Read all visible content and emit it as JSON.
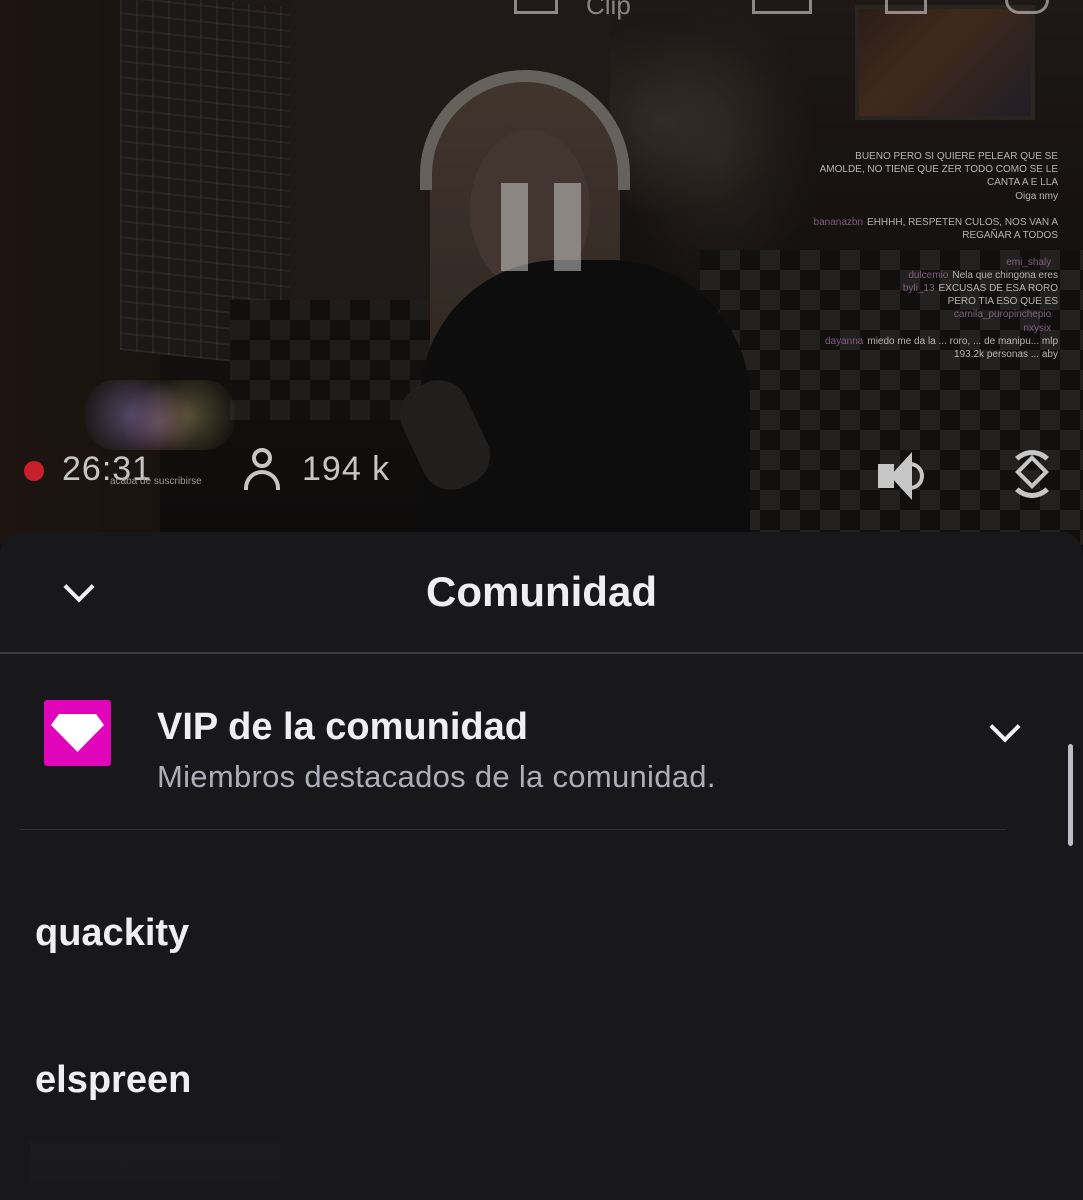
{
  "video": {
    "top_label": "Clip",
    "stream_time": "26:31",
    "viewer_count": "194 k",
    "sub_notification": "acaba de suscribirse",
    "live_indicator_color": "#c8202a",
    "chat": [
      {
        "user": "",
        "message": "BUENO PERO SI QUIERE PELEAR QUE SE AMOLDE, NO TIENE QUE ZER TODO COMO SE LE CANTA A E LLA"
      },
      {
        "user": "",
        "message": "Oiga nmy"
      },
      {
        "user": "",
        "message": ""
      },
      {
        "user": "bananazbn",
        "message": "EHHHH, RESPETEN CULOS, NOS VAN A REGAÑAR A TODOS"
      },
      {
        "user": "",
        "message": ""
      },
      {
        "user": "emi_shaly",
        "message": ""
      },
      {
        "user": "dulcemio",
        "message": "Nela que chingona eres"
      },
      {
        "user": "byli_13",
        "message": "EXCUSAS DE ESA RORO"
      },
      {
        "user": "",
        "message": "PERO TIA ESO QUE ES"
      },
      {
        "user": "camila_puropinchepio",
        "message": ""
      },
      {
        "user": "nxysix",
        "message": ""
      },
      {
        "user": "dayanna",
        "message": "miedo me da la ... roro, ... de manipu... mlp"
      },
      {
        "user": "",
        "message": "193.2k personas ... aby"
      }
    ]
  },
  "sheet": {
    "title": "Comunidad",
    "section": {
      "title": "VIP de la comunidad",
      "subtitle": "Miembros destacados de la comunidad.",
      "badge_color": "#e005b9"
    },
    "members": [
      "quackity",
      "elspreen"
    ]
  },
  "icons": {
    "collapse": "chevron-down-icon",
    "expand": "chevron-down-icon",
    "badge": "diamond-icon",
    "viewers": "person-icon",
    "volume": "volume-icon",
    "rotate": "rotate-screen-icon"
  }
}
